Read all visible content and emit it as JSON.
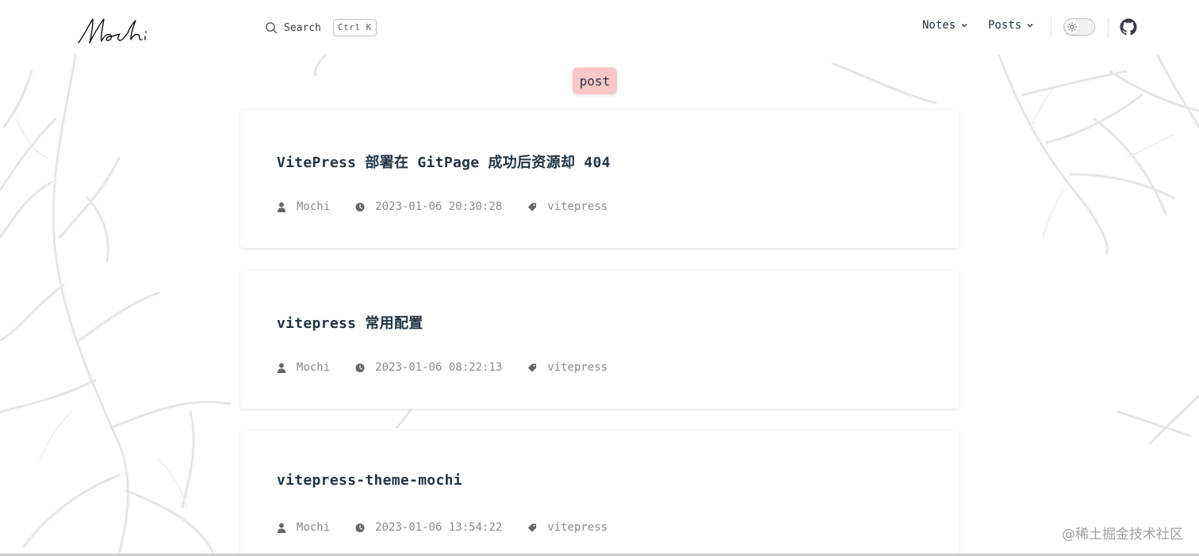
{
  "nav": {
    "logo_text": "Mochi",
    "search_label": "Search",
    "search_shortcut": "Ctrl K",
    "menus": [
      {
        "label": "Notes"
      },
      {
        "label": "Posts"
      }
    ],
    "theme_toggle_icon": "sun-icon",
    "github_icon": "github-icon"
  },
  "tag": {
    "label": "post",
    "color": "#f9c7c7"
  },
  "posts": [
    {
      "title": "VitePress 部署在 GitPage 成功后资源却 404",
      "author": "Mochi",
      "date": "2023-01-06 20:30:28",
      "tag": "vitepress"
    },
    {
      "title": "vitepress 常用配置",
      "author": "Mochi",
      "date": "2023-01-06 08:22:13",
      "tag": "vitepress"
    },
    {
      "title": "vitepress-theme-mochi",
      "author": "Mochi",
      "date": "2023-01-06 13:54:22",
      "tag": "vitepress"
    }
  ],
  "watermark": "@稀土掘金技术社区",
  "colors": {
    "text": "#213547",
    "meta": "#8a8a8f",
    "tag_bg": "#f9c7c7"
  }
}
